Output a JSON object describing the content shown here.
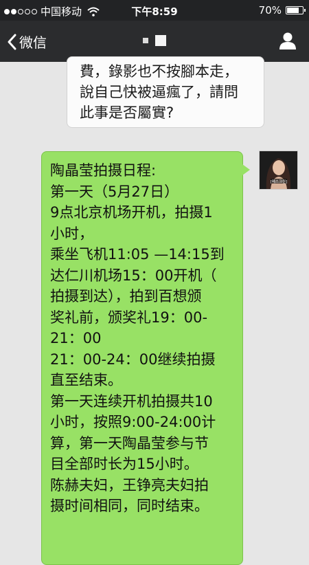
{
  "status_bar": {
    "carrier": "中国移动",
    "time": "下午8:59",
    "battery": "70%",
    "battery_level": 0.7,
    "signal_bars_filled": 2,
    "signal_bars_total": 5
  },
  "nav": {
    "back_label": "微信"
  },
  "messages": {
    "incoming_lines": [
      "費，錄影也不按腳本走，",
      "說自己快被逼瘋了，請問",
      "此事是否屬實?"
    ],
    "outgoing_lines": [
      "陶晶莹拍摄日程:",
      "第一天（5月27日）",
      "9点北京机场开机，拍摄1",
      "小时，",
      "乘坐飞机11:05 —14:15到",
      "达仁川机场15：00开机（",
      "拍摄到达），拍到百想颁",
      "奖礼前，颁奖礼19：00-",
      "21：00",
      "21：00-24：00继续拍摄",
      "直至结束。",
      "第一天连续开机拍摄共10",
      "小时，按照9:00-24:00计",
      "算，第一天陶晶莹参与节",
      "目全部时长为15小时。",
      "陈赫夫妇，王铮亮夫妇拍",
      "摄时间相同，同时结束。"
    ]
  },
  "avatar": {
    "caption": "[메스크린]"
  },
  "colors": {
    "status_bg": "#222325",
    "nav_bg": "#2b2c2e",
    "chat_bg": "#e6e6e6",
    "incoming_bubble": "#fbfbfb",
    "outgoing_bubble": "#98e165"
  }
}
